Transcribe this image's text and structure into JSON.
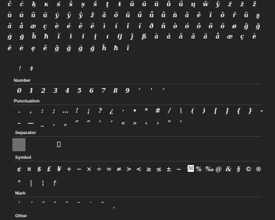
{
  "sections": {
    "number": "Number",
    "punctuation": "Punctuation",
    "separator": "Separator",
    "symbol": "Symbol",
    "mark": "Mark",
    "other": "Other"
  },
  "glyph_rows": {
    "r1": [
      "ĉ",
      "ċ",
      "ķ",
      "ĸ",
      "ś",
      "ŝ",
      "ş",
      "š",
      "ţ",
      "ŧ",
      "ũ",
      "ū",
      "ŭ",
      "ů",
      "ű",
      "ų",
      "ŵ",
      "ŷ",
      "ź",
      "ż",
      "ž"
    ],
    "r2": [
      "ù",
      "ú",
      "û",
      "ü",
      "ý",
      "ÿ",
      "ŷ",
      "ž",
      "ǎ",
      "ǒ",
      "ǔ",
      "ǘ",
      "ǚ",
      "ǜ",
      "ǹ",
      "ȁ",
      "ȅ",
      "ȉ",
      "ȍ",
      "ȑ",
      "ȕ",
      "ȿ"
    ],
    "r3": [
      "ä",
      "å",
      "æ",
      "ç",
      "è",
      "é",
      "ê",
      "ë",
      "ì",
      "í",
      "î",
      "ï",
      "ð",
      "ñ",
      "ò",
      "ó",
      "ô",
      "õ",
      "ö",
      "ø",
      "ĝ",
      "ğ"
    ],
    "r4": [
      "ġ",
      "ģ",
      "ĥ",
      "ħ",
      "ĩ",
      "ī",
      "ĭ",
      "į",
      "ı",
      "ĳ",
      "ĵ",
      "ß",
      "à",
      "á",
      "â",
      "ã",
      "ä",
      "å",
      "æ",
      "ç",
      "è"
    ],
    "r5": [
      "ĕ",
      "ė",
      "ę",
      "ě",
      "ĝ",
      "ğ",
      "ġ",
      "ģ",
      "ĥ",
      "ħ",
      "ĩ"
    ],
    "r6": [
      "ǃ",
      "ǂ"
    ],
    "numbers": [
      "0",
      "1",
      "2",
      "3",
      "4",
      "5",
      "6",
      "7",
      "8",
      "9",
      "'",
      "'",
      "'"
    ],
    "punct1": [
      ".",
      ",",
      ":",
      ";",
      "…",
      "!",
      "¡",
      "?",
      "¿",
      "·",
      "•",
      "*",
      "#",
      "/",
      "\\",
      "(",
      ")",
      "[",
      "]",
      "{",
      "}",
      "-"
    ],
    "punct2": [
      "–",
      "—",
      "_",
      "‚",
      "„",
      "“",
      "”",
      "‘",
      "’",
      "«",
      "»",
      "‹",
      "›",
      "\"",
      "'"
    ],
    "symbols1": [
      "¢",
      "¤",
      "$",
      "£",
      "¥",
      "+",
      "−",
      "×",
      "÷",
      "=",
      "≠",
      ">",
      "<",
      "≥",
      "≤",
      "±",
      "~",
      "^",
      "%",
      "‰",
      "@",
      "&",
      "§",
      "©",
      "®"
    ],
    "symbols2": [
      "°",
      "|",
      "¦",
      "†"
    ],
    "marks": [
      "`",
      "´",
      "˝",
      "ˆ",
      "ˇ",
      "˘",
      "˙",
      "˜",
      "¸"
    ]
  },
  "symbol_box_char": "ℳ"
}
